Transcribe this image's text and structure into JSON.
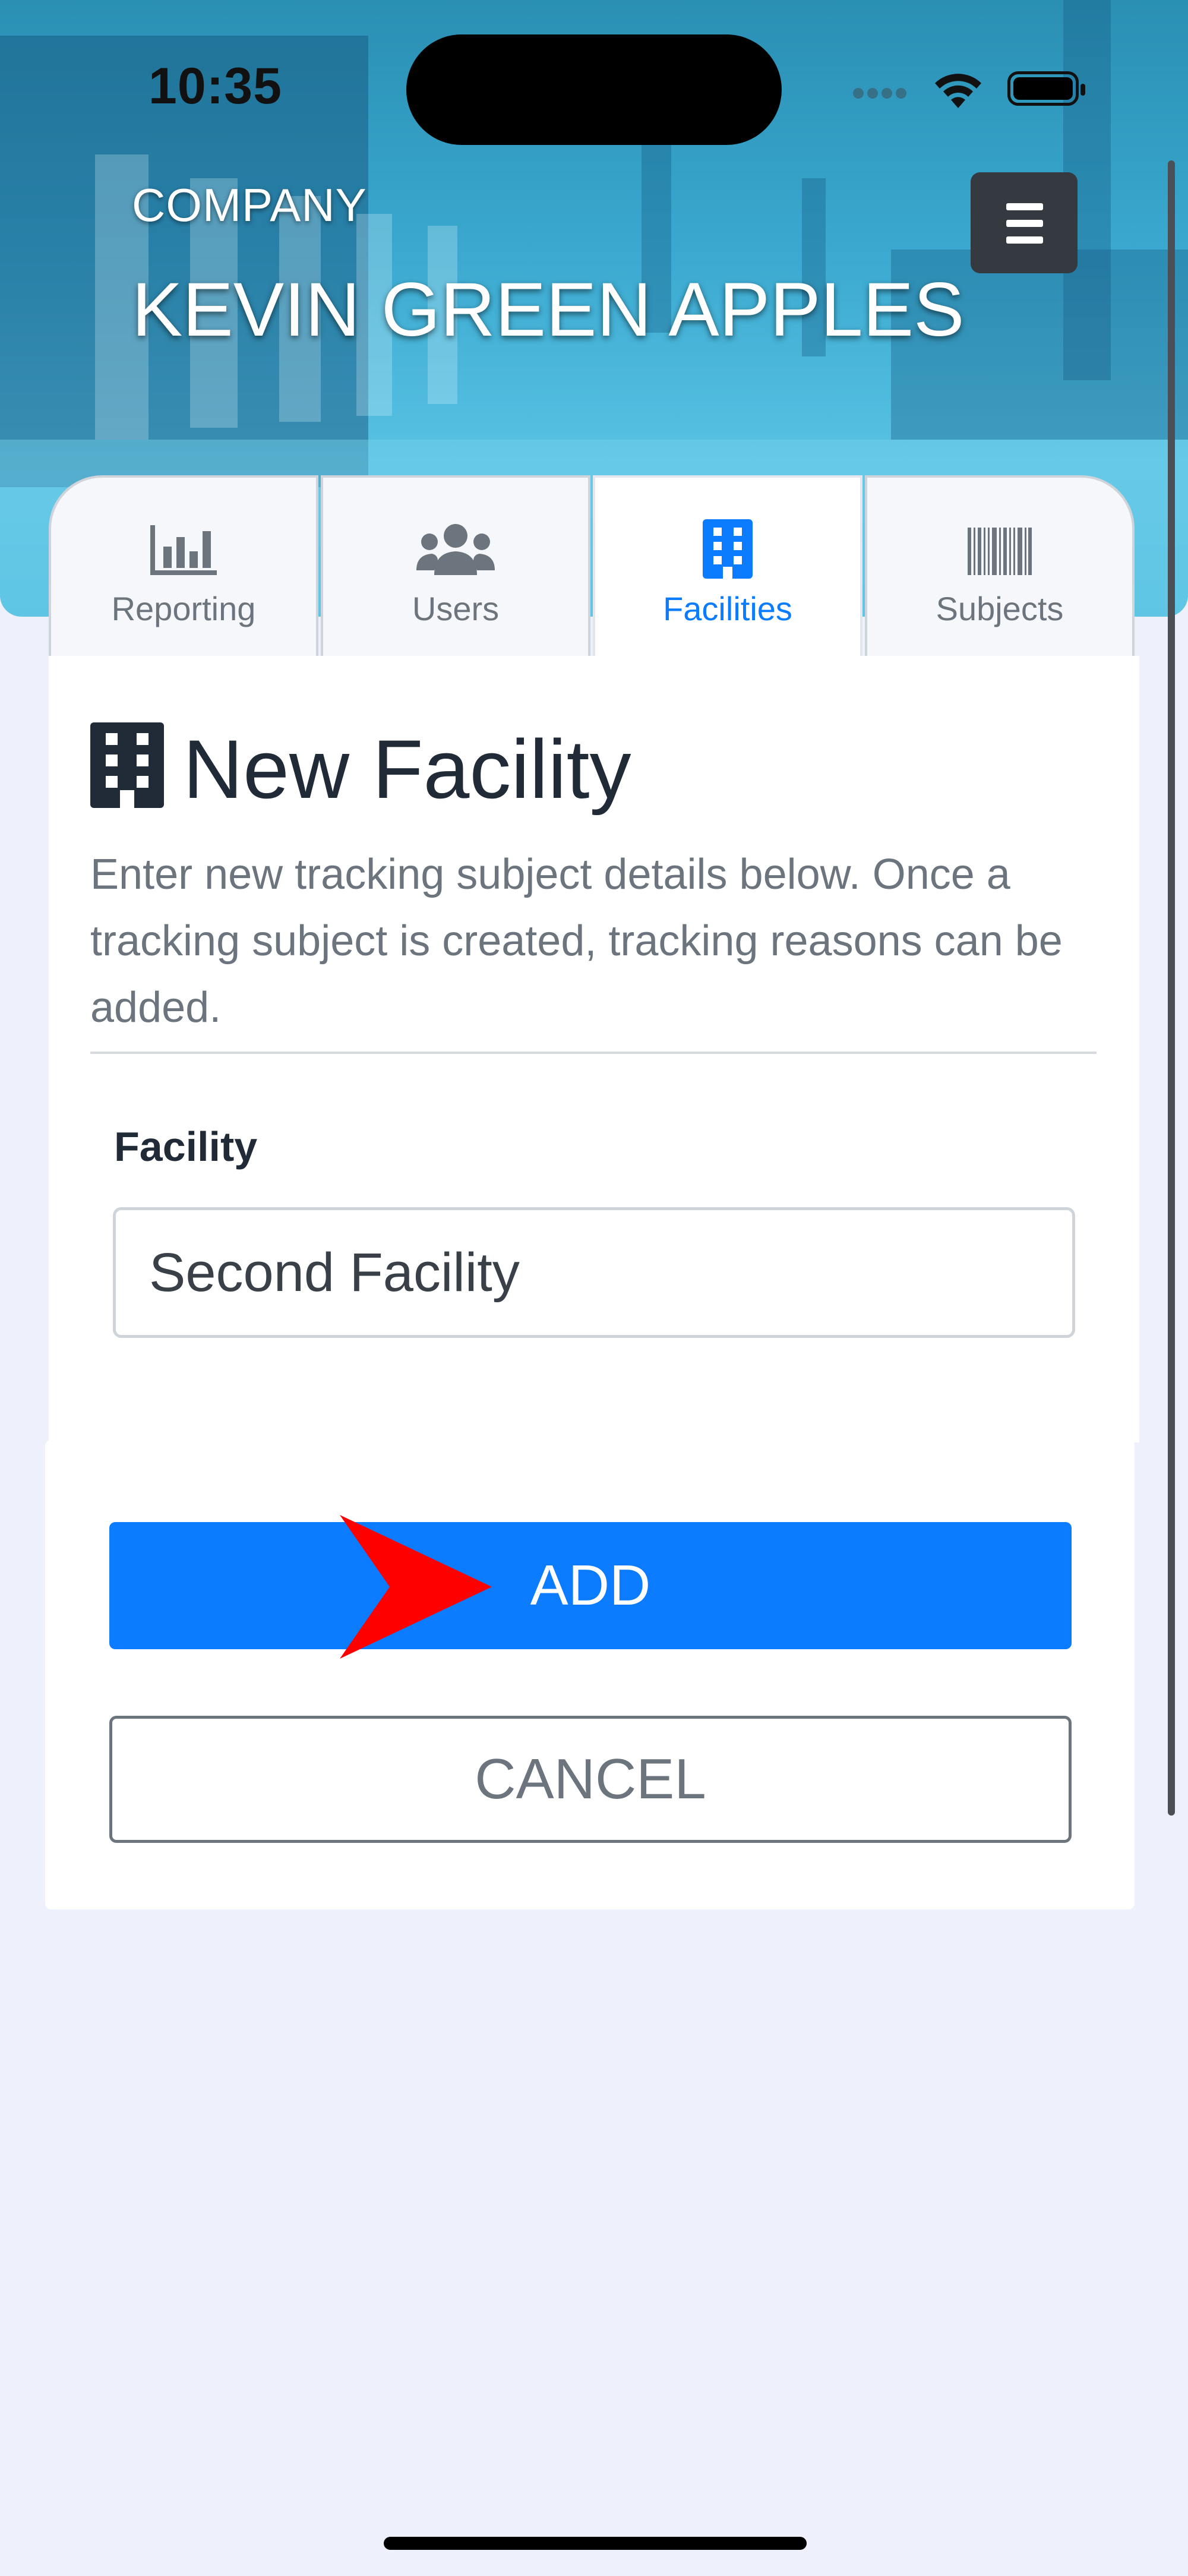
{
  "status_bar": {
    "time": "10:35"
  },
  "header": {
    "company_label": "COMPANY",
    "company_name": "KEVIN GREEN APPLES"
  },
  "tabs": [
    {
      "label": "Reporting",
      "icon": "bar-chart-icon",
      "active": false
    },
    {
      "label": "Users",
      "icon": "users-icon",
      "active": false
    },
    {
      "label": "Facilities",
      "icon": "building-icon",
      "active": true
    },
    {
      "label": "Subjects",
      "icon": "barcode-icon",
      "active": false
    }
  ],
  "form": {
    "title": "New Facility",
    "title_icon": "building-icon",
    "description": "Enter new tracking subject details below. Once a tracking subject is created, tracking reasons can be added.",
    "facility_label": "Facility",
    "facility_value": "Second Facility",
    "add_label": "ADD",
    "cancel_label": "CANCEL"
  },
  "colors": {
    "primary": "#0b7bff",
    "text_dark": "#212b37",
    "text_muted": "#6c757d",
    "header": "#3aa8cf",
    "annotation_arrow": "#ff0000"
  }
}
